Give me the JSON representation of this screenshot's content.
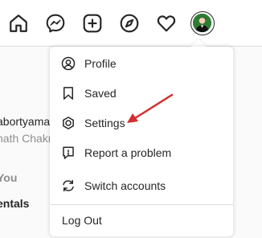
{
  "background": {
    "username_fragment": "abortyama",
    "fullname_fragment": "nath Chakr",
    "section_fragment": "You",
    "suggestion_fragment": "entals"
  },
  "nav": {
    "icons": [
      "home-icon",
      "messenger-icon",
      "new-post-icon",
      "explore-icon",
      "activity-heart-icon",
      "profile-avatar"
    ]
  },
  "menu": {
    "items": [
      {
        "label": "Profile",
        "icon": "profile-icon"
      },
      {
        "label": "Saved",
        "icon": "bookmark-icon"
      },
      {
        "label": "Settings",
        "icon": "settings-gear-icon"
      },
      {
        "label": "Report a problem",
        "icon": "report-problem-icon"
      },
      {
        "label": "Switch accounts",
        "icon": "switch-accounts-icon"
      }
    ],
    "logout_label": "Log Out"
  },
  "colors": {
    "annotation_arrow": "#d32f2f",
    "avatar_bg": "#2e7d32",
    "divider": "#dbdbdb",
    "text": "#262626"
  }
}
